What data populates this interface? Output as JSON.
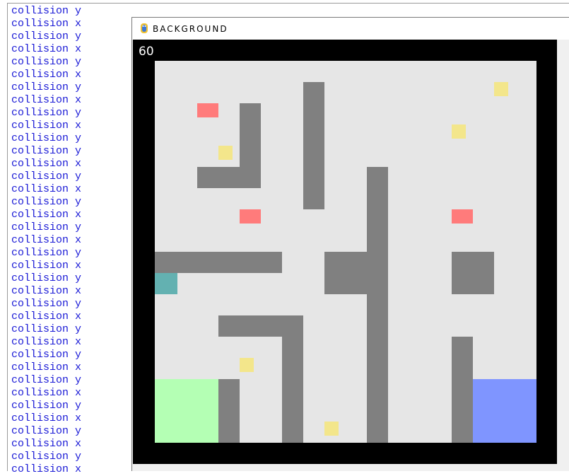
{
  "console": {
    "lines": [
      "collision y",
      "collision x",
      "collision y",
      "collision x",
      "collision y",
      "collision x",
      "collision y",
      "collision x",
      "collision y",
      "collision x",
      "collision y",
      "collision y",
      "collision x",
      "collision y",
      "collision x",
      "collision y",
      "collision x",
      "collision y",
      "collision x",
      "collision y",
      "collision x",
      "collision y",
      "collision x",
      "collision y",
      "collision x",
      "collision y",
      "collision x",
      "collision y",
      "collision x",
      "collision y",
      "collision x",
      "collision y",
      "collision x",
      "collision y",
      "collision x",
      "collision y",
      "collision x"
    ],
    "text_color": "#1a1ad6"
  },
  "window": {
    "title": "BACKGROUND",
    "icon": "pygame-snake-icon"
  },
  "game": {
    "fps": "60",
    "colors": {
      "border": "#000000",
      "floor": "#e6e6e6",
      "wall": "#808080",
      "coin": "#f3e68b",
      "enemy": "#ff7b7b",
      "player": "#63b1b1",
      "start_zone": "#b4ffb4",
      "goal_zone": "#7f95ff"
    }
  }
}
